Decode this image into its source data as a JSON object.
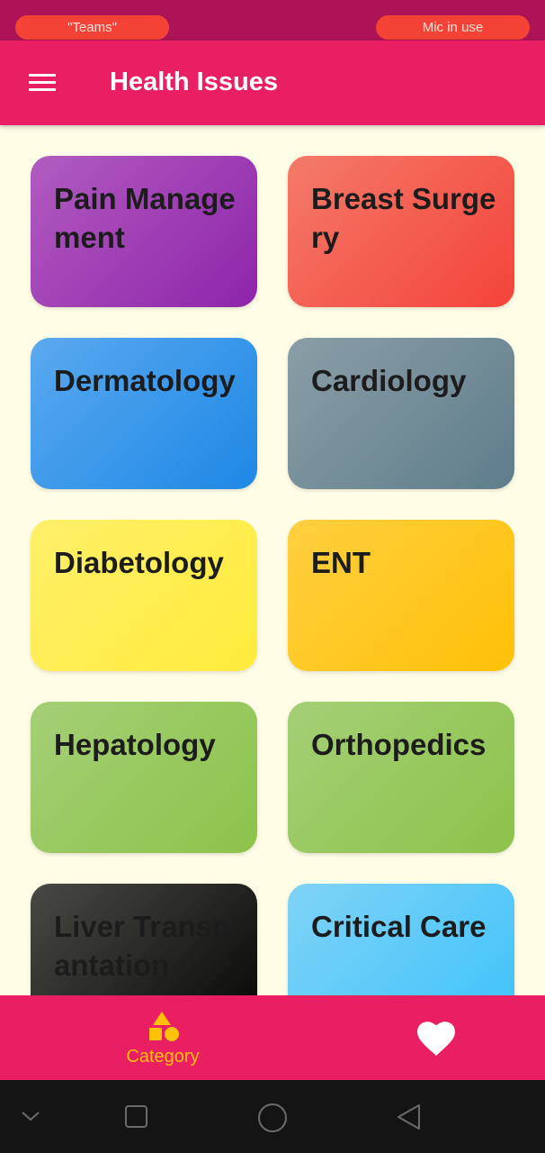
{
  "status_bar": {
    "left_pill": "\"Teams\"",
    "right_pill": "Mic in use"
  },
  "app_bar": {
    "title": "Health Issues",
    "menu_icon": "hamburger-menu-icon"
  },
  "categories": [
    {
      "label": "Pain Management",
      "colors": [
        "#b15cc0",
        "#8e24aa"
      ]
    },
    {
      "label": "Breast Surgery",
      "colors": [
        "#f47a6a",
        "#f4433a"
      ]
    },
    {
      "label": "Dermatology",
      "colors": [
        "#5aa9ef",
        "#1e88e5"
      ]
    },
    {
      "label": "Cardiology",
      "colors": [
        "#8a9ea6",
        "#5f7d8c"
      ]
    },
    {
      "label": "Diabetology",
      "colors": [
        "#fff06a",
        "#ffeb3b"
      ]
    },
    {
      "label": "ENT",
      "colors": [
        "#ffcf3f",
        "#ffc107"
      ]
    },
    {
      "label": "Hepatology",
      "colors": [
        "#a5cf76",
        "#8bc34a"
      ]
    },
    {
      "label": "Orthopedics",
      "colors": [
        "#a5cf76",
        "#8bc34a"
      ]
    },
    {
      "label": "Liver Transplantation",
      "colors": [
        "#4a4a44",
        "#050505"
      ]
    },
    {
      "label": "Critical Care",
      "colors": [
        "#7fd3f6",
        "#3ec2fb"
      ]
    }
  ],
  "bottom_nav": {
    "category_label": "Category",
    "category_icon": "shapes-icon",
    "favorites_icon": "heart-icon",
    "active_color": "#ffc107",
    "bar_color": "#e91e63"
  },
  "system_nav": {
    "icons": [
      "chevron-down-icon",
      "square-recents-icon",
      "circle-home-icon",
      "triangle-back-icon"
    ]
  }
}
